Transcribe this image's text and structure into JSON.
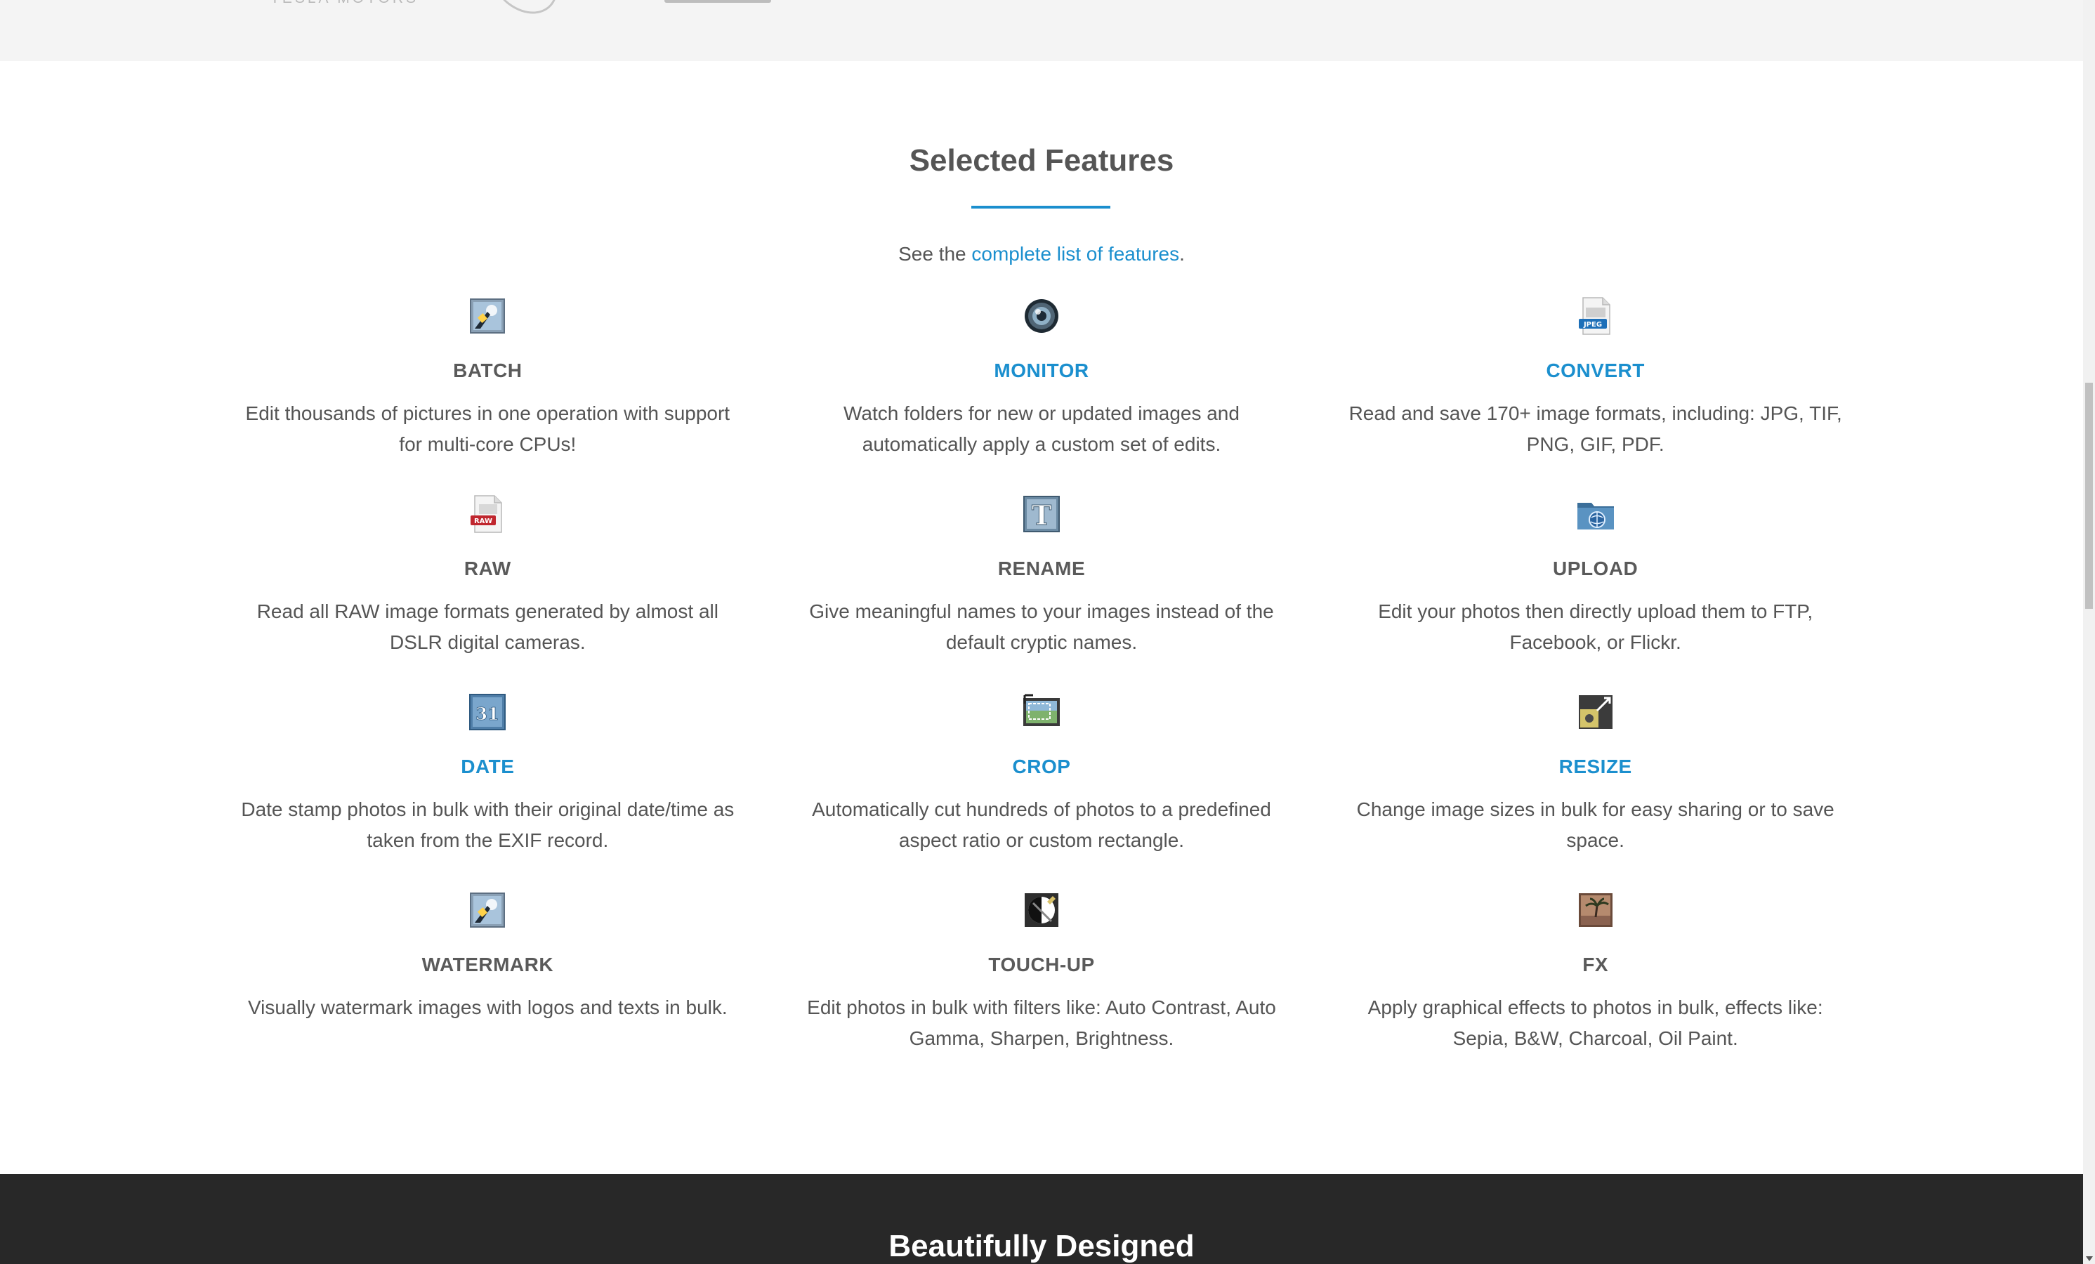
{
  "logos": {
    "tesla_text": "TESLA MOTORS"
  },
  "features_section": {
    "title": "Selected Features",
    "subtitle_prefix": "See the ",
    "subtitle_link": "complete list of features",
    "subtitle_suffix": ".",
    "accent_color": "#1b8fce",
    "items": [
      {
        "name": "BATCH",
        "icon": "batch-icon",
        "highlighted": false,
        "desc": "Edit thousands of pictures in one operation with support for multi-core CPUs!"
      },
      {
        "name": "MONITOR",
        "icon": "monitor-icon",
        "highlighted": true,
        "desc": "Watch folders for new or updated images and automatically apply a custom set of edits."
      },
      {
        "name": "CONVERT",
        "icon": "convert-icon",
        "highlighted": true,
        "desc": "Read and save 170+ image formats, including: JPG, TIF, PNG, GIF, PDF."
      },
      {
        "name": "RAW",
        "icon": "raw-icon",
        "highlighted": false,
        "desc": "Read all RAW image formats generated by almost all DSLR digital cameras."
      },
      {
        "name": "RENAME",
        "icon": "rename-icon",
        "highlighted": false,
        "desc": "Give meaningful names to your images instead of the default cryptic names."
      },
      {
        "name": "UPLOAD",
        "icon": "upload-icon",
        "highlighted": false,
        "desc": "Edit your photos then directly upload them to FTP, Facebook, or Flickr."
      },
      {
        "name": "DATE",
        "icon": "date-icon",
        "highlighted": true,
        "desc": "Date stamp photos in bulk with their original date/time as taken from the EXIF record."
      },
      {
        "name": "CROP",
        "icon": "crop-icon",
        "highlighted": true,
        "desc": "Automatically cut hundreds of photos to a predefined aspect ratio or custom rectangle."
      },
      {
        "name": "RESIZE",
        "icon": "resize-icon",
        "highlighted": true,
        "desc": "Change image sizes in bulk for easy sharing or to save space."
      },
      {
        "name": "WATERMARK",
        "icon": "watermark-icon",
        "highlighted": false,
        "desc": "Visually watermark images with logos and texts in bulk."
      },
      {
        "name": "TOUCH-UP",
        "icon": "touch-up-icon",
        "highlighted": false,
        "desc": "Edit photos in bulk with filters like: Auto Contrast, Auto Gamma, Sharpen, Brightness."
      },
      {
        "name": "FX",
        "icon": "fx-icon",
        "highlighted": false,
        "desc": "Apply graphical effects to photos in bulk, effects like: Sepia, B&W, Charcoal, Oil Paint."
      }
    ],
    "icon_text": {
      "convert": "JPEG",
      "raw": "RAW",
      "rename": "T",
      "date": "31"
    }
  },
  "dark_section": {
    "title": "Beautifully Designed"
  }
}
